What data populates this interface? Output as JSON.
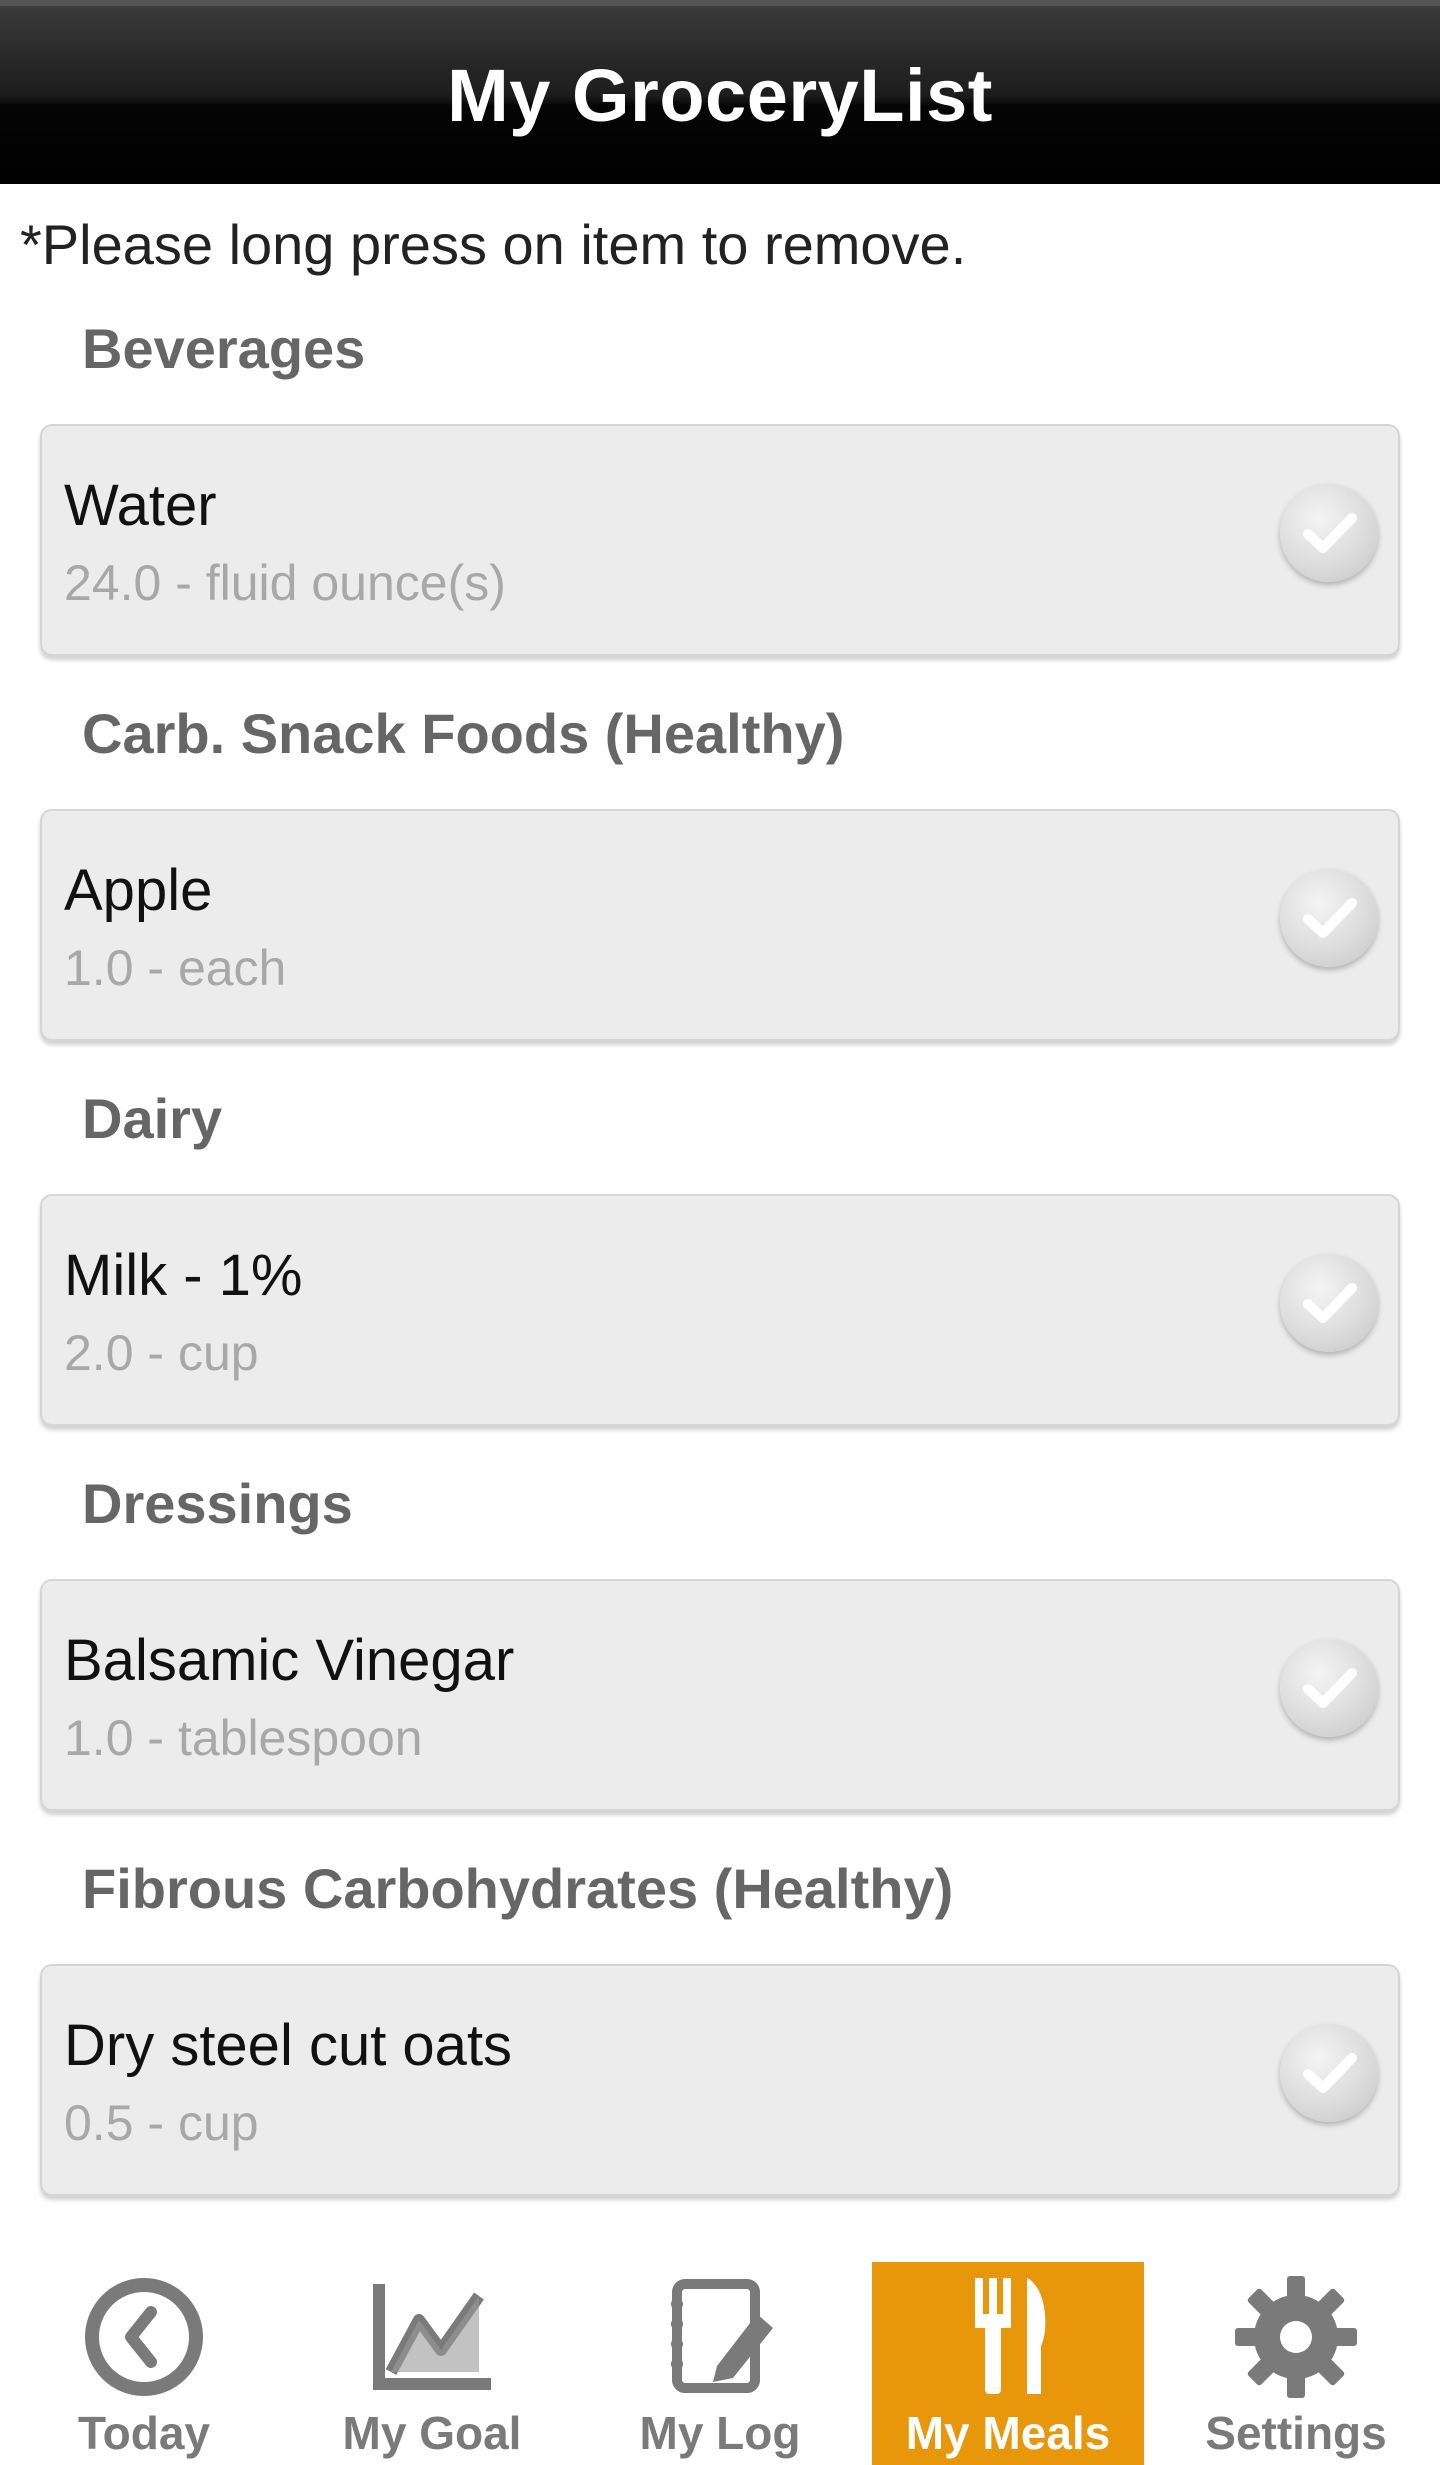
{
  "header": {
    "title": "My GroceryList"
  },
  "hint": "*Please long press on item to remove.",
  "sections": [
    {
      "title": "Beverages",
      "item": {
        "name": "Water",
        "qty": "24.0 - fluid ounce(s)"
      }
    },
    {
      "title": "Carb. Snack Foods (Healthy)",
      "item": {
        "name": "Apple",
        "qty": "1.0 - each"
      }
    },
    {
      "title": "Dairy",
      "item": {
        "name": "Milk - 1%",
        "qty": "2.0 - cup"
      }
    },
    {
      "title": "Dressings",
      "item": {
        "name": "Balsamic Vinegar",
        "qty": "1.0 - tablespoon"
      }
    },
    {
      "title": "Fibrous Carbohydrates (Healthy)",
      "item": {
        "name": "Dry steel cut oats",
        "qty": "0.5 - cup"
      }
    }
  ],
  "tabs": [
    {
      "label": "Today",
      "icon": "clock-icon"
    },
    {
      "label": "My Goal",
      "icon": "chart-icon"
    },
    {
      "label": "My Log",
      "icon": "notepad-icon"
    },
    {
      "label": "My Meals",
      "icon": "fork-knife-icon",
      "active": true
    },
    {
      "label": "Settings",
      "icon": "gear-icon"
    }
  ],
  "colors": {
    "active_tab": "#e8960a",
    "header_bg": "#000000"
  }
}
